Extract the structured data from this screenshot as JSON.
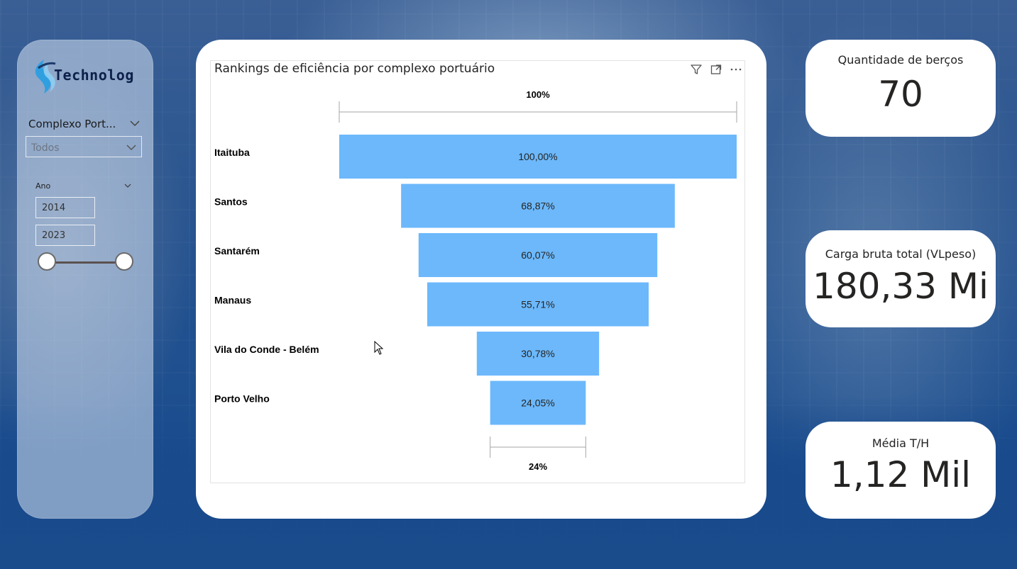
{
  "app": {
    "brand": "Technolog"
  },
  "slicers": {
    "complexo": {
      "title": "Complexo Port...",
      "selected": "Todos"
    },
    "ano": {
      "title": "Ano",
      "from": "2014",
      "to": "2023"
    }
  },
  "chart": {
    "title": "Rankings de eficiência por complexo portuário",
    "toolbar": [
      "filter-icon",
      "focus-mode-icon",
      "more-options-icon"
    ],
    "top_label": "100%",
    "bottom_label": "24%"
  },
  "chart_data": {
    "type": "funnel",
    "title": "Rankings de eficiência por complexo portuário",
    "categories": [
      "Itaituba",
      "Santos",
      "Santarém",
      "Manaus",
      "Vila do Conde - Belém",
      "Porto Velho"
    ],
    "values": [
      100.0,
      68.87,
      60.07,
      55.71,
      30.78,
      24.05
    ],
    "value_labels": [
      "100,00%",
      "68,87%",
      "60,07%",
      "55,71%",
      "30,78%",
      "24,05%"
    ],
    "unit": "%",
    "bar_color": "#6cb8fb"
  },
  "kpis": [
    {
      "label": "Quantidade de berços",
      "value": "70"
    },
    {
      "label": "Carga bruta total (VLpeso)",
      "value": "180,33 Mi"
    },
    {
      "label": "Média T/H",
      "value": "1,12 Mil"
    }
  ]
}
